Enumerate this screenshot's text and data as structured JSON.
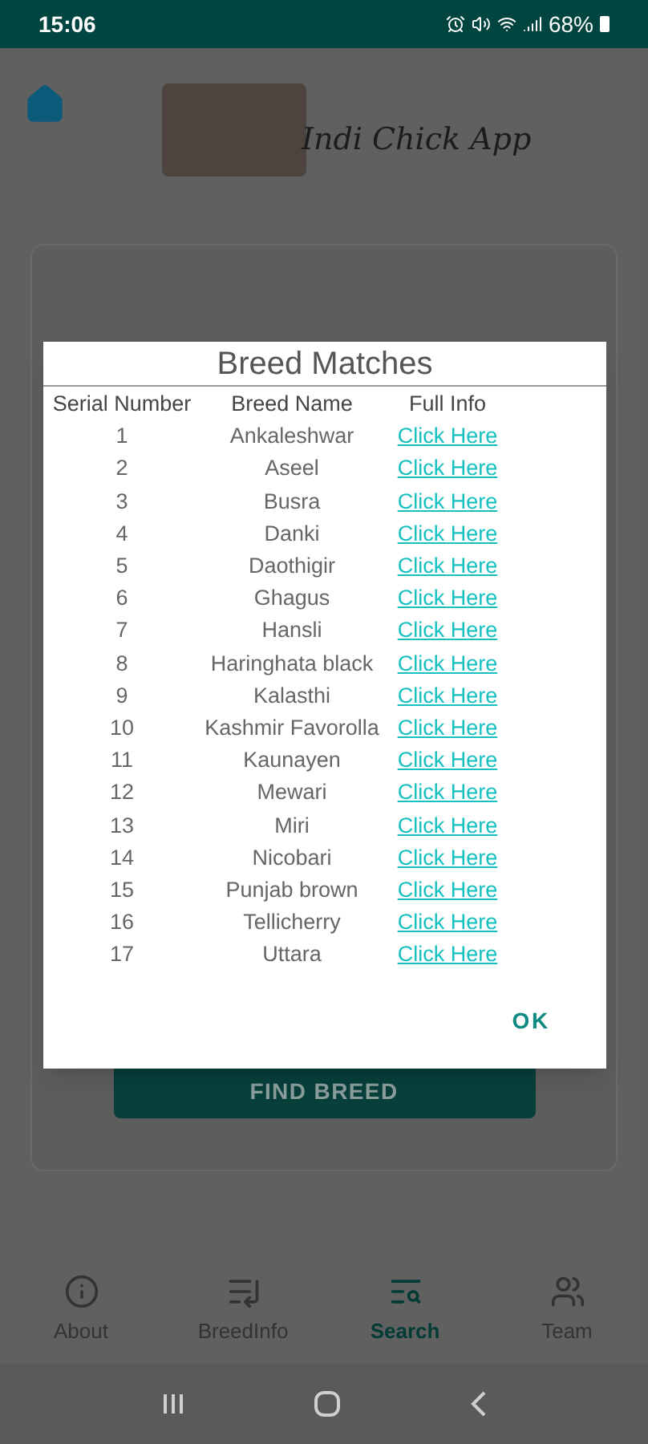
{
  "status_bar": {
    "time": "15:06",
    "battery": "68%"
  },
  "header": {
    "app_title": "Indi Chick App"
  },
  "card": {
    "button": "FIND BREED"
  },
  "dialog": {
    "title": "Breed Matches",
    "columns": [
      "Serial Number",
      "Breed Name",
      "Full Info"
    ],
    "rows": [
      {
        "serial": "1",
        "name": "Ankaleshwar",
        "link": "Click Here"
      },
      {
        "serial": "2",
        "name": "Aseel",
        "link": "Click Here"
      },
      {
        "serial": "3",
        "name": "Busra",
        "link": "Click Here"
      },
      {
        "serial": "4",
        "name": "Danki",
        "link": "Click Here"
      },
      {
        "serial": "5",
        "name": "Daothigir",
        "link": "Click Here"
      },
      {
        "serial": "6",
        "name": "Ghagus",
        "link": "Click Here"
      },
      {
        "serial": "7",
        "name": "Hansli",
        "link": "Click Here"
      },
      {
        "serial": "8",
        "name": "Haringhata black",
        "link": "Click Here"
      },
      {
        "serial": "9",
        "name": "Kalasthi",
        "link": "Click Here"
      },
      {
        "serial": "10",
        "name": "Kashmir Favorolla",
        "link": "Click Here"
      },
      {
        "serial": "11",
        "name": "Kaunayen",
        "link": "Click Here"
      },
      {
        "serial": "12",
        "name": "Mewari",
        "link": "Click Here"
      },
      {
        "serial": "13",
        "name": "Miri",
        "link": "Click Here"
      },
      {
        "serial": "14",
        "name": "Nicobari",
        "link": "Click Here"
      },
      {
        "serial": "15",
        "name": "Punjab brown",
        "link": "Click Here"
      },
      {
        "serial": "16",
        "name": "Tellicherry",
        "link": "Click Here"
      },
      {
        "serial": "17",
        "name": "Uttara",
        "link": "Click Here"
      }
    ],
    "ok_button": "OK"
  },
  "bottom_nav": [
    {
      "kind": "info",
      "label": "About",
      "selected": false
    },
    {
      "kind": "list",
      "label": "BreedInfo",
      "selected": false
    },
    {
      "kind": "search",
      "label": "Search",
      "selected": true
    },
    {
      "kind": "team",
      "label": "Team",
      "selected": false
    }
  ]
}
